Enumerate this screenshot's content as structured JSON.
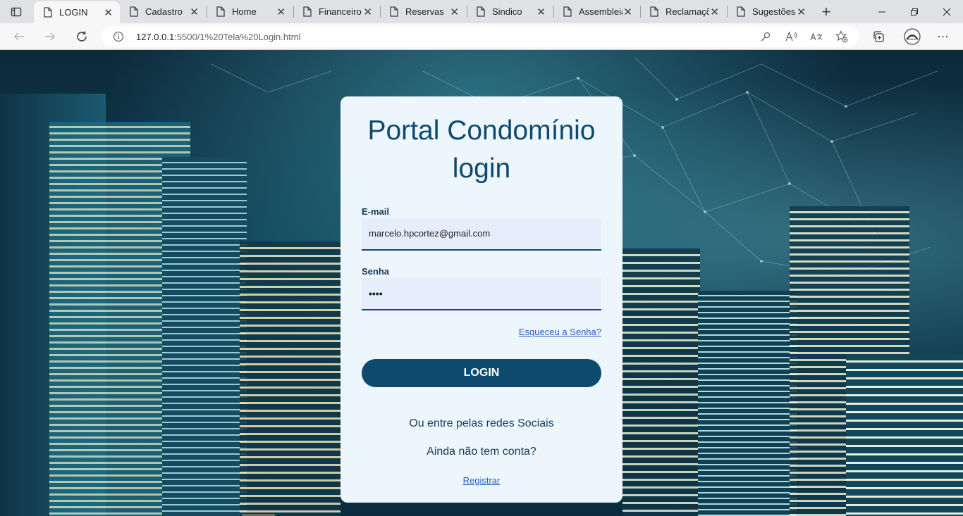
{
  "browser": {
    "tabs": [
      {
        "label": "LOGIN",
        "active": true
      },
      {
        "label": "Cadastro",
        "active": false
      },
      {
        "label": "Home",
        "active": false
      },
      {
        "label": "Financeiro",
        "active": false
      },
      {
        "label": "Reservas",
        "active": false
      },
      {
        "label": "Sindico",
        "active": false
      },
      {
        "label": "Assembleia",
        "active": false
      },
      {
        "label": "Reclamações",
        "active": false
      },
      {
        "label": "Sugestões",
        "active": false
      }
    ],
    "url_host": "127.0.0.1",
    "url_rest": ":5500/1%20Tela%20Login.html"
  },
  "login": {
    "title_line1": "Portal Condomínio",
    "title_line2": "login",
    "email_label": "E-mail",
    "email_value": "marcelo.hpcortez@gmail.com",
    "password_label": "Senha",
    "password_value": "••••",
    "forgot_link": "Esqueceu a Senha?",
    "login_button": "LOGIN",
    "social_text": "Ou entre pelas redes Sociais",
    "no_account_text": "Ainda não tem conta?",
    "register_link": "Registrar"
  },
  "colors": {
    "brand": "#0c4a6e",
    "card_bg": "#eef6fd",
    "link": "#2760b6"
  }
}
